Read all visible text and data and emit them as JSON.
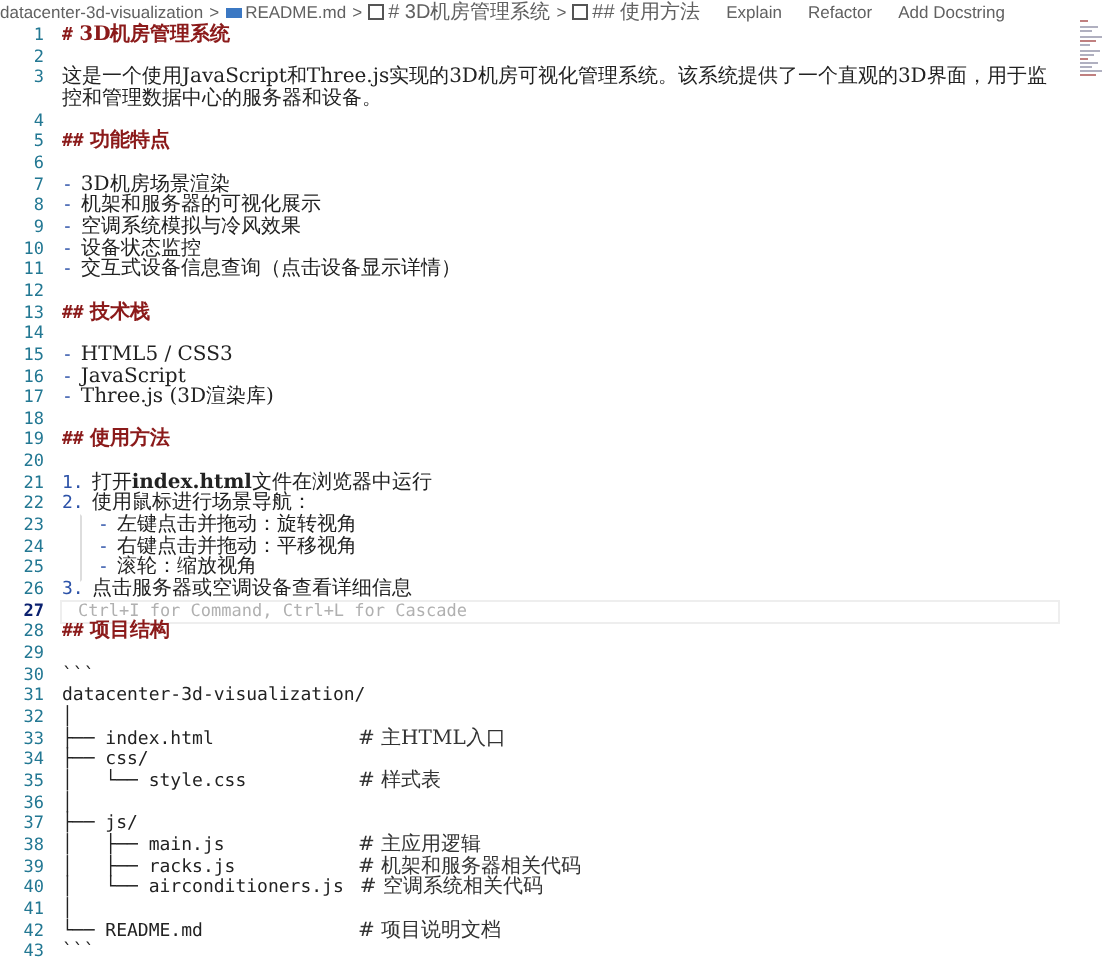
{
  "breadcrumb": {
    "separator": ">",
    "items": [
      {
        "kind": "folder",
        "text": "datacenter-3d-visualization"
      },
      {
        "kind": "file",
        "text": "README.md"
      },
      {
        "kind": "symbol",
        "text": "# 3D机房管理系统"
      },
      {
        "kind": "symbol",
        "text": "## 使用方法"
      }
    ],
    "actions": [
      "Explain",
      "Refactor",
      "Add Docstring"
    ]
  },
  "lines": [
    {
      "number": "1",
      "kind": "heading",
      "marker": "#",
      "text": "3D机房管理系统",
      "active": false
    },
    {
      "number": "2",
      "kind": "blank",
      "active": false
    },
    {
      "number": "3",
      "kind": "text",
      "text": "这是一个使用JavaScript和Three.js实现的3D机房可视化管理系统。该系统提供了一个直观的3D界面，用于监控和管理数据中心的服务器和设备。",
      "active": false
    },
    {
      "number": "4",
      "kind": "blank",
      "active": false
    },
    {
      "number": "5",
      "kind": "heading",
      "marker": "##",
      "text": "功能特点",
      "active": false
    },
    {
      "number": "6",
      "kind": "blank",
      "active": false
    },
    {
      "number": "7",
      "kind": "bullet",
      "marker": "-",
      "text": "3D机房场景渲染",
      "active": false
    },
    {
      "number": "8",
      "kind": "bullet",
      "marker": "-",
      "text": "机架和服务器的可视化展示",
      "active": false
    },
    {
      "number": "9",
      "kind": "bullet",
      "marker": "-",
      "text": "空调系统模拟与冷风效果",
      "active": false
    },
    {
      "number": "10",
      "kind": "bullet",
      "marker": "-",
      "text": "设备状态监控",
      "active": false
    },
    {
      "number": "11",
      "kind": "bullet",
      "marker": "-",
      "text": "交互式设备信息查询（点击设备显示详情）",
      "active": false
    },
    {
      "number": "12",
      "kind": "blank",
      "active": false
    },
    {
      "number": "13",
      "kind": "heading",
      "marker": "##",
      "text": "技术栈",
      "active": false
    },
    {
      "number": "14",
      "kind": "blank",
      "active": false
    },
    {
      "number": "15",
      "kind": "bullet",
      "marker": "-",
      "text": "HTML5 / CSS3",
      "active": false
    },
    {
      "number": "16",
      "kind": "bullet",
      "marker": "-",
      "text": "JavaScript",
      "active": false
    },
    {
      "number": "17",
      "kind": "bullet",
      "marker": "-",
      "text": "Three.js (3D渲染库)",
      "active": false
    },
    {
      "number": "18",
      "kind": "blank",
      "active": false
    },
    {
      "number": "19",
      "kind": "heading",
      "marker": "##",
      "text": "使用方法",
      "active": false
    },
    {
      "number": "20",
      "kind": "blank",
      "active": false
    },
    {
      "number": "21",
      "kind": "bullet",
      "marker": "1.",
      "text": "打开**index.html**文件在浏览器中运行",
      "active": false
    },
    {
      "number": "22",
      "kind": "bullet",
      "marker": "2.",
      "text": "使用鼠标进行场景导航：",
      "active": false,
      "children": [
        {
          "number": "23",
          "kind": "bullet",
          "marker": "-",
          "text": "左键点击并拖动：旋转视角",
          "active": false
        },
        {
          "number": "24",
          "kind": "bullet",
          "marker": "-",
          "text": "右键点击并拖动：平移视角",
          "active": false
        },
        {
          "number": "25",
          "kind": "bullet",
          "marker": "-",
          "text": "滚轮：缩放视角",
          "active": false
        }
      ]
    },
    {
      "number": "26",
      "kind": "bullet",
      "marker": "3.",
      "text": "点击服务器或空调设备查看详细信息",
      "active": false
    },
    {
      "number": "27",
      "kind": "hint",
      "text": "Ctrl+I for Command, Ctrl+L for Cascade",
      "active": true
    },
    {
      "number": "28",
      "kind": "heading",
      "marker": "##",
      "text": "项目结构",
      "active": false
    },
    {
      "number": "29",
      "kind": "blank",
      "active": false
    },
    {
      "number": "30",
      "kind": "code",
      "text": "```",
      "active": false
    },
    {
      "number": "31",
      "kind": "code",
      "text": "datacenter-3d-visualization/",
      "active": false
    },
    {
      "number": "32",
      "kind": "code",
      "text": "│",
      "active": false
    },
    {
      "number": "33",
      "kind": "code",
      "text": "├── index.html",
      "comment": "# 主HTML入口",
      "active": false
    },
    {
      "number": "34",
      "kind": "code",
      "text": "├── css/",
      "active": false
    },
    {
      "number": "35",
      "kind": "code",
      "text": "│   └── style.css",
      "comment": "# 样式表",
      "active": false
    },
    {
      "number": "36",
      "kind": "code",
      "text": "│",
      "active": false
    },
    {
      "number": "37",
      "kind": "code",
      "text": "├── js/",
      "active": false
    },
    {
      "number": "38",
      "kind": "code",
      "text": "│   ├── main.js",
      "comment": "# 主应用逻辑",
      "active": false
    },
    {
      "number": "39",
      "kind": "code",
      "text": "│   ├── racks.js",
      "comment": "# 机架和服务器相关代码",
      "active": false
    },
    {
      "number": "40",
      "kind": "code",
      "text": "│   └── airconditioners.js",
      "comment": "# 空调系统相关代码",
      "active": false
    },
    {
      "number": "41",
      "kind": "code",
      "text": "│",
      "active": false
    },
    {
      "number": "42",
      "kind": "code",
      "text": "└── README.md",
      "comment": "# 项目说明文档",
      "active": false
    },
    {
      "number": "43",
      "kind": "code",
      "text": "```",
      "active": false
    }
  ]
}
